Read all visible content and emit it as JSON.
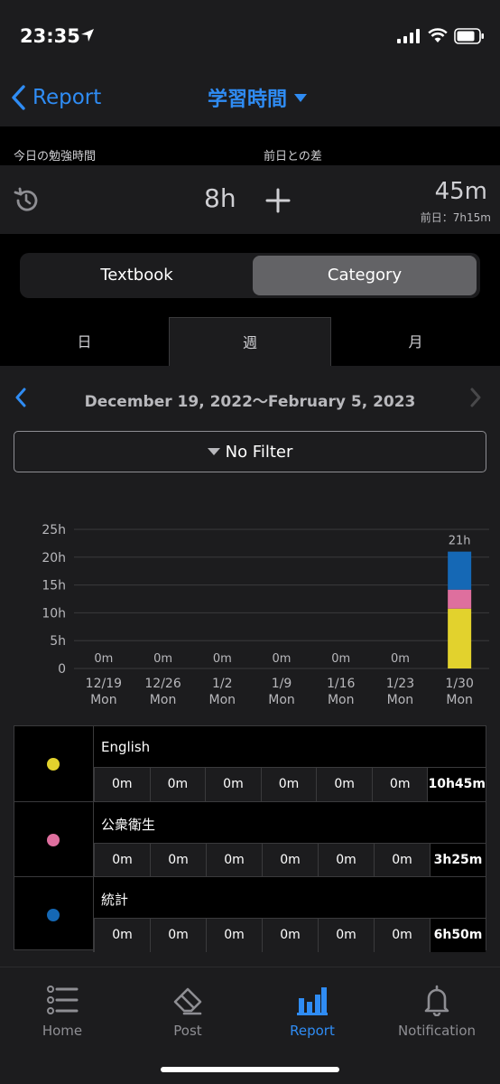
{
  "status": {
    "time": "23:35"
  },
  "nav": {
    "back_label": "Report",
    "title": "学習時間"
  },
  "summary": {
    "today_label": "今日の勉強時間",
    "diff_label": "前日との差",
    "today_value": "8h",
    "diff_value": "45m",
    "prev_value": "前日：7h15m"
  },
  "segment": {
    "left": "Textbook",
    "right": "Category",
    "selected": "Category"
  },
  "period_tabs": [
    {
      "label": "日"
    },
    {
      "label": "週"
    },
    {
      "label": "月"
    }
  ],
  "period_selected": "週",
  "range": {
    "text": "December 19, 2022〜February 5, 2023"
  },
  "filter": {
    "label": "No Filter"
  },
  "chart_data": {
    "type": "bar",
    "stacked": true,
    "categories": [
      "12/19\nMon",
      "12/26\nMon",
      "1/2\nMon",
      "1/9\nMon",
      "1/16\nMon",
      "1/23\nMon",
      "1/30\nMon"
    ],
    "x_tick_labels": [
      [
        "12/19",
        "Mon"
      ],
      [
        "12/26",
        "Mon"
      ],
      [
        "1/2",
        "Mon"
      ],
      [
        "1/9",
        "Mon"
      ],
      [
        "1/16",
        "Mon"
      ],
      [
        "1/23",
        "Mon"
      ],
      [
        "1/30",
        "Mon"
      ]
    ],
    "series": [
      {
        "name": "English",
        "color": "#e2d22d",
        "values": [
          0,
          0,
          0,
          0,
          0,
          0,
          10.75
        ]
      },
      {
        "name": "公衆衛生",
        "color": "#de6f9e",
        "values": [
          0,
          0,
          0,
          0,
          0,
          0,
          3.4167
        ]
      },
      {
        "name": "統計",
        "color": "#1568b5",
        "values": [
          0,
          0,
          0,
          0,
          0,
          0,
          6.8333
        ]
      }
    ],
    "data_labels": [
      "0m",
      "0m",
      "0m",
      "0m",
      "0m",
      "0m",
      "21h"
    ],
    "y_ticks": [
      0,
      5,
      10,
      15,
      20,
      25
    ],
    "y_tick_labels": [
      "0",
      "5h",
      "10h",
      "15h",
      "20h",
      "25h"
    ],
    "ylim": [
      0,
      25
    ],
    "grid": true
  },
  "legend": [
    {
      "name": "English",
      "color": "#e2d22d",
      "cells": [
        "0m",
        "0m",
        "0m",
        "0m",
        "0m",
        "0m"
      ],
      "total": [
        "10h",
        "45m"
      ]
    },
    {
      "name": "公衆衛生",
      "color": "#de6f9e",
      "cells": [
        "0m",
        "0m",
        "0m",
        "0m",
        "0m",
        "0m"
      ],
      "total": [
        "3h",
        "25m"
      ]
    },
    {
      "name": "統計",
      "color": "#1568b5",
      "cells": [
        "0m",
        "0m",
        "0m",
        "0m",
        "0m",
        "0m"
      ],
      "total": [
        "6h",
        "50m"
      ]
    }
  ],
  "tabbar": [
    {
      "label": "Home",
      "icon": "list-icon"
    },
    {
      "label": "Post",
      "icon": "eraser-icon"
    },
    {
      "label": "Report",
      "icon": "bar-chart-icon"
    },
    {
      "label": "Notification",
      "icon": "bell-icon"
    }
  ],
  "tabbar_selected": "Report",
  "colors": {
    "accent": "#2f8cf4",
    "background": "#1c1c1e"
  }
}
